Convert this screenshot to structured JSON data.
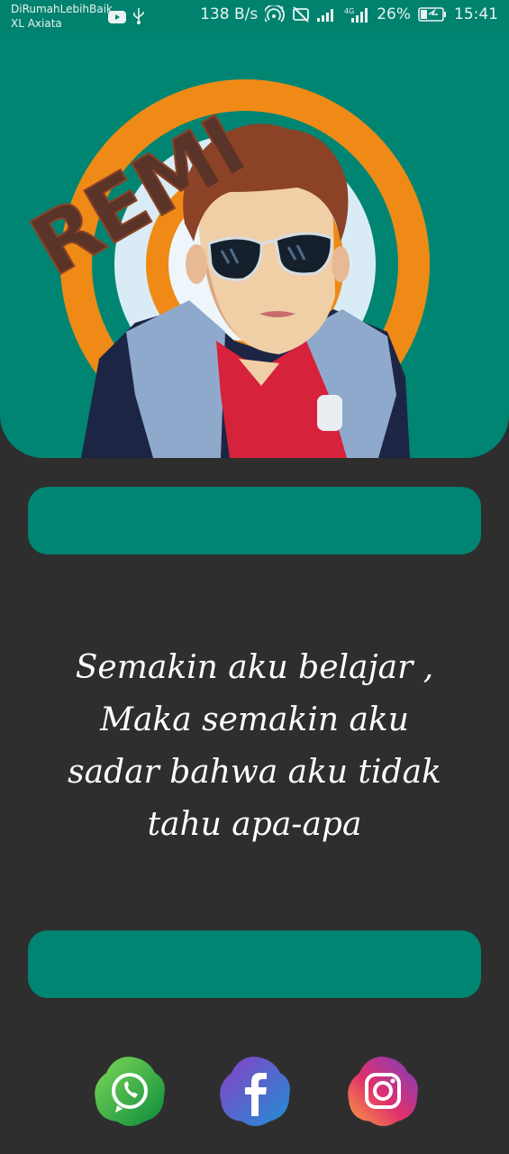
{
  "status_bar": {
    "carrier_line1": "DiRumahLebihBaik",
    "carrier_line2": "XL Axiata",
    "net_speed": "138 B/s",
    "battery_percent": "26%",
    "time": "15:41",
    "icons": [
      "youtube-icon",
      "usb-icon",
      "hotspot-icon",
      "no-sim-icon",
      "signal-icon",
      "signal-4g-icon",
      "battery-charging-icon"
    ]
  },
  "header": {
    "artwork_text": "REMI",
    "colors": {
      "background": "#008572",
      "orange_ring": "#ef8a17",
      "shirt": "#d6223a",
      "jacket": "#7f9bc0"
    }
  },
  "quote": {
    "text": "Semakin aku belajar ,\nMaka semakin aku\nsadar bahwa aku tidak\ntahu apa-apa"
  },
  "social": [
    {
      "icon": "whatsapp-icon"
    },
    {
      "icon": "facebook-icon"
    },
    {
      "icon": "instagram-icon"
    }
  ],
  "colors": {
    "page_background": "#2e2e2e",
    "accent": "#008572"
  }
}
